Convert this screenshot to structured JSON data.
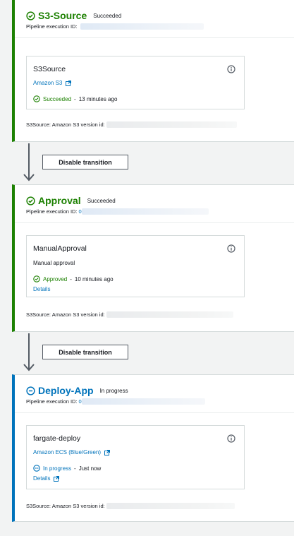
{
  "stages": [
    {
      "name": "S3-Source",
      "status": "Succeeded",
      "exec_label": "Pipeline execution ID:",
      "exec_prefix": "",
      "action": {
        "name": "S3Source",
        "provider": "Amazon S3",
        "status": "Succeeded",
        "time": "13 minutes ago",
        "details": ""
      },
      "version_label": "S3Source: Amazon S3 version id:"
    },
    {
      "name": "Approval",
      "status": "Succeeded",
      "exec_label": "Pipeline execution ID:",
      "exec_prefix": "0",
      "action": {
        "name": "ManualApproval",
        "provider": "Manual approval",
        "status": "Approved",
        "time": "10 minutes ago",
        "details": "Details"
      },
      "version_label": "S3Source: Amazon S3 version id:"
    },
    {
      "name": "Deploy-App",
      "status": "In progress",
      "exec_label": "Pipeline execution ID:",
      "exec_prefix": "0",
      "action": {
        "name": "fargate-deploy",
        "provider": "Amazon ECS (Blue/Green)",
        "status": "In progress",
        "time": "Just now",
        "details": "Details"
      },
      "version_label": "S3Source: Amazon S3 version id:"
    }
  ],
  "transitions": [
    {
      "button": "Disable transition"
    },
    {
      "button": "Disable transition"
    }
  ],
  "colors": {
    "success": "#1d8102",
    "in_progress": "#0073bb",
    "link": "#0073bb"
  },
  "icons": {
    "success": "check-circle-icon",
    "in_progress": "progress-circle-icon",
    "info": "info-icon",
    "external": "external-link-icon",
    "arrow": "arrow-down-icon"
  }
}
